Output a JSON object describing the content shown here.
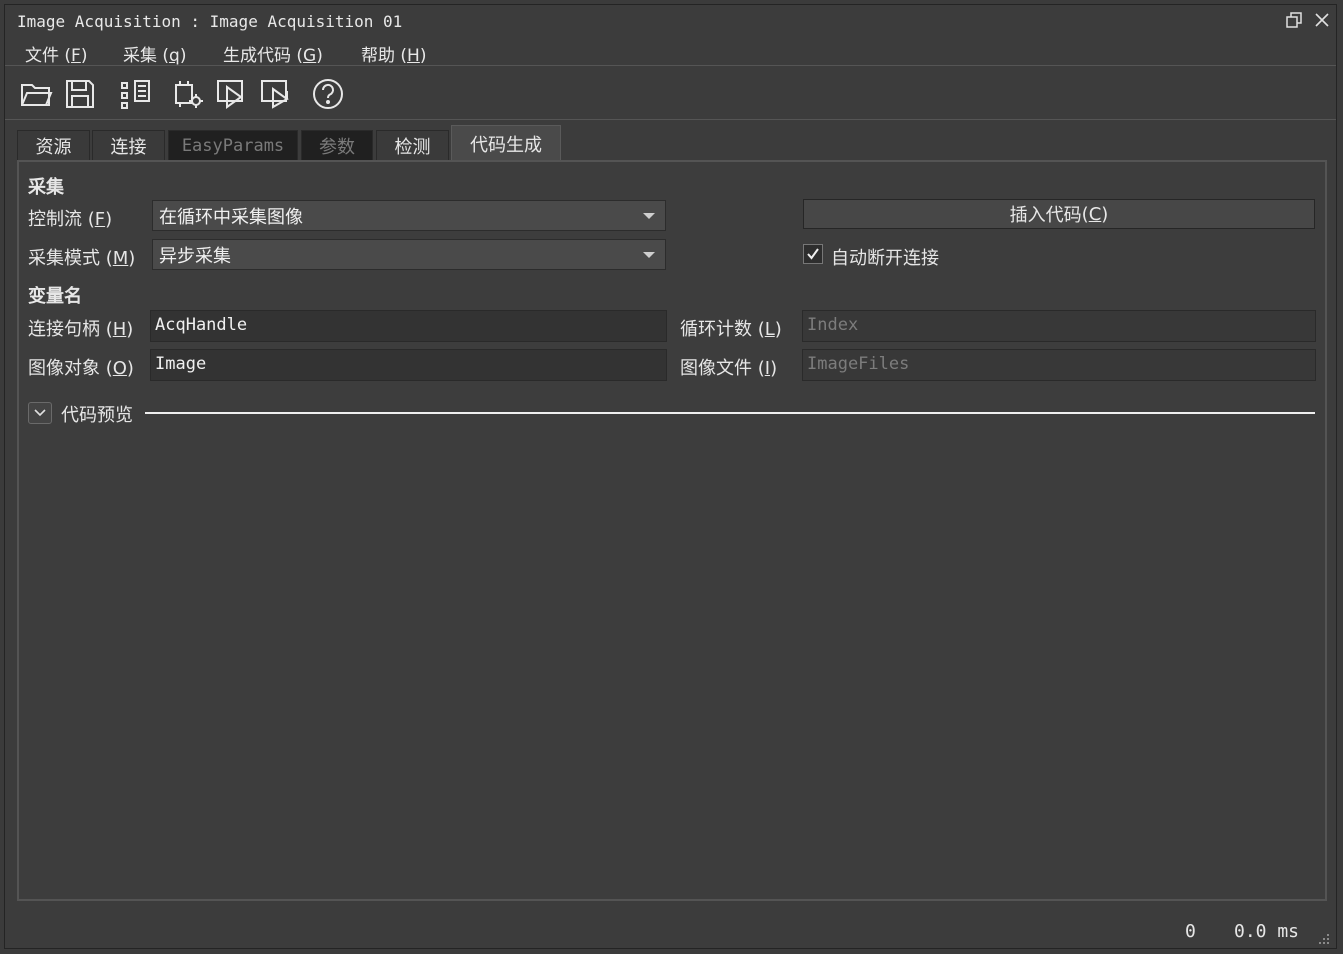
{
  "window": {
    "title": "Image Acquisition : Image Acquisition 01"
  },
  "menu": {
    "items": [
      {
        "label": "文件",
        "open": " (",
        "key": "F",
        "close": ")"
      },
      {
        "label": "采集",
        "open": " (",
        "key": "q",
        "close": ")"
      },
      {
        "label": "生成代码",
        "open": " (",
        "key": "G",
        "close": ")"
      },
      {
        "label": "帮助",
        "open": " (",
        "key": "H",
        "close": ")"
      }
    ]
  },
  "toolbar": {
    "icons": [
      "open-folder-icon",
      "save-icon",
      "device-list-icon",
      "device-settings-icon",
      "snap-icon",
      "live-icon",
      "help-icon"
    ]
  },
  "tabs": [
    {
      "label": "资源",
      "state": "normal"
    },
    {
      "label": "连接",
      "state": "normal"
    },
    {
      "label": "EasyParams",
      "state": "disabled"
    },
    {
      "label": "参数",
      "state": "disabled"
    },
    {
      "label": "检测",
      "state": "normal"
    },
    {
      "label": "代码生成",
      "state": "active"
    }
  ],
  "acquisition": {
    "section_label": "采集",
    "control_flow_label": "控制流",
    "control_flow_open": " (",
    "control_flow_key": "F",
    "control_flow_close": ")",
    "control_flow_value": "在循环中采集图像",
    "mode_label": "采集模式",
    "mode_open": " (",
    "mode_key": "M",
    "mode_close": ")",
    "mode_value": "异步采集",
    "insert_code_label": "插入代码",
    "insert_code_open": " (",
    "insert_code_key": "C",
    "insert_code_close": ")",
    "auto_disconnect_label": "自动断开连接",
    "auto_disconnect_checked": true
  },
  "variables": {
    "section_label": "变量名",
    "handle_label": "连接句柄",
    "handle_open": " (",
    "handle_key": "H",
    "handle_close": ")",
    "handle_value": "AcqHandle",
    "image_label": "图像对象",
    "image_open": " (",
    "image_key": "O",
    "image_close": ")",
    "image_value": "Image",
    "loop_label": "循环计数",
    "loop_open": " (",
    "loop_key": "L",
    "loop_close": ")",
    "loop_value": "Index",
    "files_label": "图像文件",
    "files_open": " (",
    "files_key": "I",
    "files_close": ")",
    "files_value": "ImageFiles"
  },
  "preview": {
    "label": "代码预览",
    "expanded": true
  },
  "status": {
    "count": "0",
    "time": "0.0 ms"
  }
}
